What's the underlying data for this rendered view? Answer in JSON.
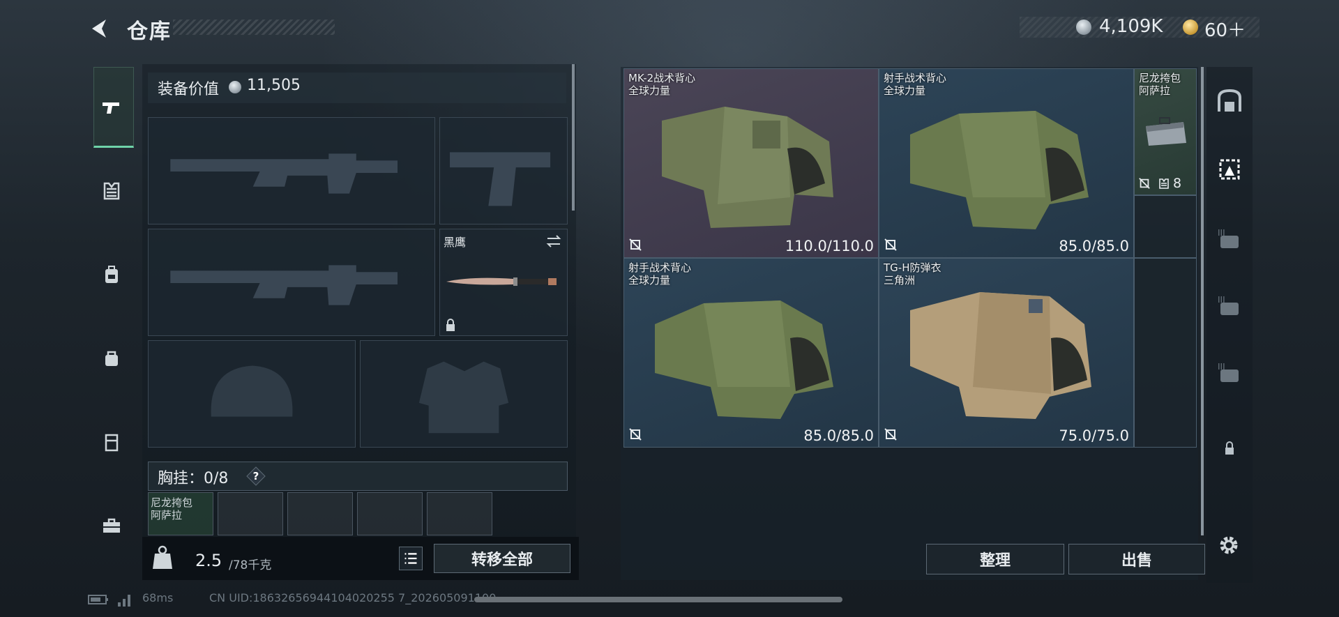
{
  "header": {
    "title": "仓库",
    "money": "4,109K",
    "tickets": "60＋"
  },
  "left_nav": {
    "items": [
      "pistol-icon",
      "armor-icon",
      "backpack-icon",
      "bag-icon",
      "container-icon",
      "briefcase-icon"
    ],
    "active": "pistol-icon"
  },
  "equipment": {
    "value_label": "装备价值",
    "value": "11,505",
    "melee_name": "黑鹰",
    "chest_rig_label": "胸挂：0/8",
    "chest_rig_item_line1": "尼龙挎包",
    "chest_rig_item_line2": "阿萨拉"
  },
  "capacity": {
    "weight": "2.5",
    "max": "/78千克",
    "transfer_all": "转移全部"
  },
  "grid": {
    "items": [
      {
        "name1": "MK-2战术背心",
        "name2": "全球力量",
        "durability": "110.0/110.0"
      },
      {
        "name1": "射手战术背心",
        "name2": "全球力量",
        "durability": "85.0/85.0"
      },
      {
        "name1": "射手战术背心",
        "name2": "全球力量",
        "durability": "85.0/85.0"
      },
      {
        "name1": "TG-H防弹衣",
        "name2": "三角洲",
        "durability": "75.0/75.0"
      },
      {
        "name1": "尼龙挎包",
        "name2": "阿萨拉",
        "count": "8"
      }
    ],
    "sort_label": "整理",
    "sell_label": "出售"
  },
  "footer": {
    "ping": "68ms",
    "uid": "CN UID:18632656944104020255 7_202605091100"
  },
  "colors": {
    "accent_green": "#6fd3a9",
    "cell_blue": "#2d4457",
    "cell_purple": "#4a4556",
    "cell_green": "#364a42"
  }
}
